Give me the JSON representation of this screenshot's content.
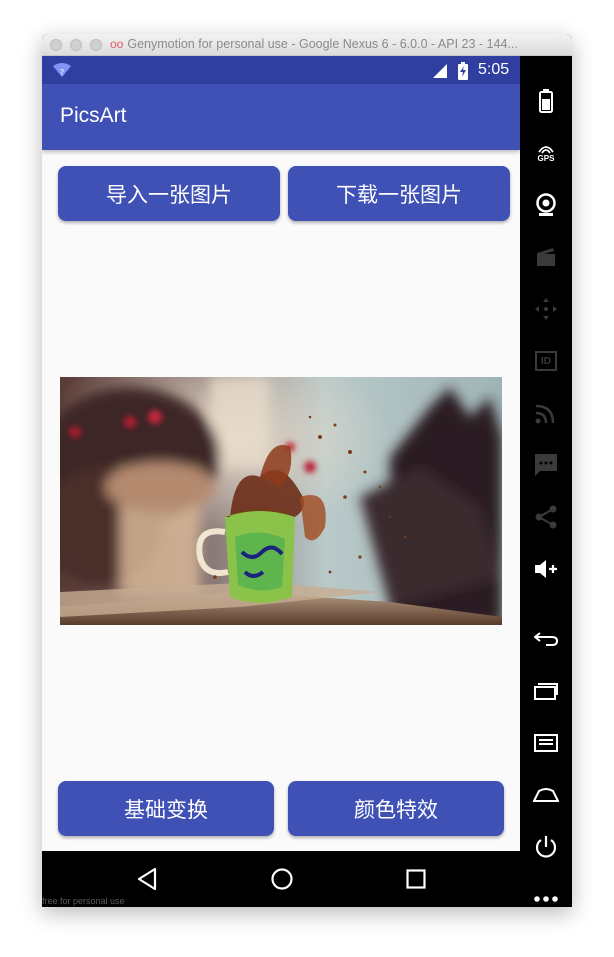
{
  "window": {
    "title": "Genymotion for personal use - Google Nexus 6 - 6.0.0 - API 23 - 144..."
  },
  "statusbar": {
    "time": "5:05"
  },
  "appbar": {
    "title": "PicsArt"
  },
  "buttons": {
    "import_label": "导入一张图片",
    "download_label": "下载一张图片",
    "basic_label": "基础变换",
    "color_label": "颜色特效"
  },
  "image": {
    "description_icon": "coffee-cup-splash-photo"
  },
  "navbar": {
    "watermark": "free for personal use"
  },
  "sidebar": {
    "icons": [
      "battery-icon",
      "gps-icon",
      "webcam-icon",
      "clapper-icon",
      "dpad-icon",
      "id-icon",
      "cast-icon",
      "sms-icon",
      "share-icon",
      "volume-up-icon",
      "back-icon",
      "recent-apps-icon",
      "menu-icon",
      "home-icon",
      "power-icon",
      "more-icon"
    ],
    "gps_label": "GPS",
    "id_label": "ID"
  },
  "colors": {
    "primary": "#3f51b5",
    "primary_dark": "#303f9f",
    "background": "#fafafa"
  }
}
